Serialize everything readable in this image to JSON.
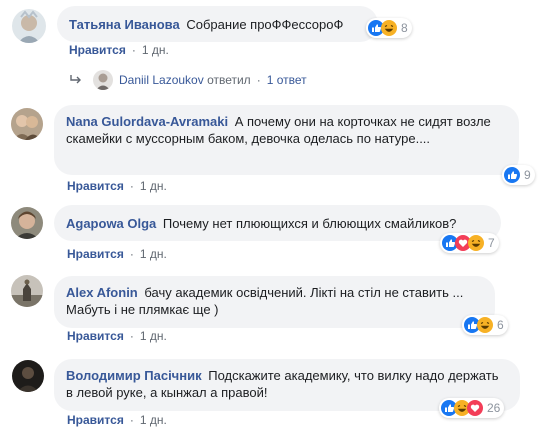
{
  "comments": [
    {
      "author": "Татьяна Иванова",
      "text": "Собрание проФФессороФ",
      "like": "Нравится",
      "time": "1 дн.",
      "reactions": [
        "like",
        "haha"
      ],
      "count": "8"
    },
    {
      "author": "Nana Gulordava-Avramaki",
      "text": "А почему они на корточках не сидят возле скамейки с муссорным баком, девочка оделась по натуре....",
      "like": "Нравится",
      "time": "1 дн.",
      "reactions": [
        "like"
      ],
      "count": "9"
    },
    {
      "author": "Agapowa Olga",
      "text": "Почему нет плюющихся и блюющих смайликов?",
      "like": "Нравится",
      "time": "1 дн.",
      "reactions": [
        "like",
        "love",
        "haha"
      ],
      "count": "7"
    },
    {
      "author": "Alex Afonin",
      "text": "бачу академик освідчений. Лікті на стіл не ставить ... Мабуть і не плямкає ще )",
      "like": "Нравится",
      "time": "1 дн.",
      "reactions": [
        "like",
        "haha"
      ],
      "count": "6"
    },
    {
      "author": "Володимир Пасічник",
      "text": "Подскажите академику, что вилку надо держать в левой руке, а кынжал а правой!",
      "like": "Нравится",
      "time": "1 дн.",
      "reactions": [
        "like",
        "haha",
        "love"
      ],
      "count": "26"
    }
  ],
  "reply": {
    "name": "Daniil Lazoukov",
    "verb": "ответил",
    "count": "1 ответ"
  },
  "colors": {
    "link": "#385898",
    "bubble": "#f2f3f5",
    "like": "#1877f2",
    "love": "#f33e58",
    "haha": "#f7b125"
  }
}
